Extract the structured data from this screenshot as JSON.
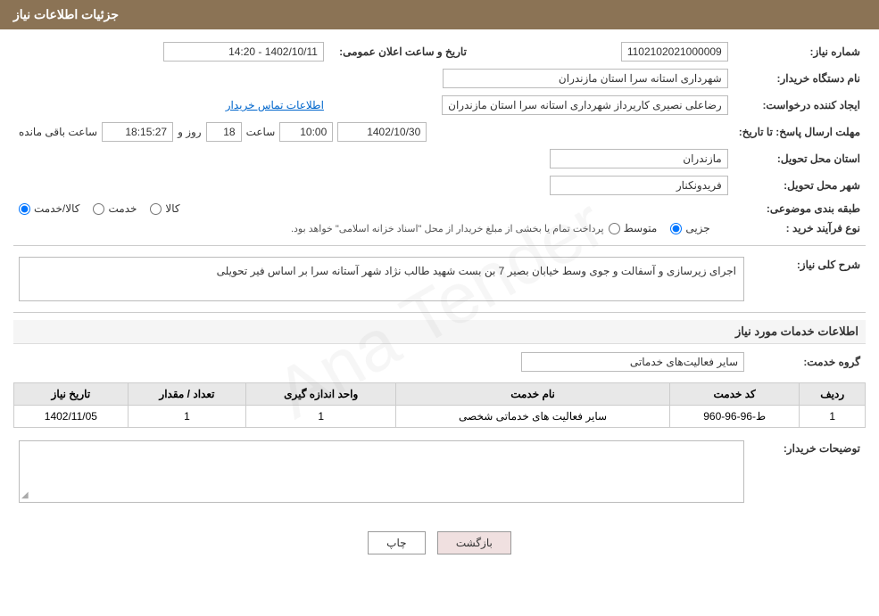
{
  "header": {
    "title": "جزئیات اطلاعات نیاز"
  },
  "fields": {
    "need_number_label": "شماره نیاز:",
    "need_number_value": "1102102021000009",
    "buyer_org_label": "نام دستگاه خریدار:",
    "buyer_org_value": "شهرداری استانه سرا استان مازندران",
    "creator_label": "ایجاد کننده درخواست:",
    "creator_value": "رضاعلی نصیری کاریرداز شهرداری استانه سرا استان مازندران",
    "creator_link": "اطلاعات تماس خریدار",
    "announce_date_label": "تاریخ و ساعت اعلان عمومی:",
    "announce_date_value": "1402/10/11 - 14:20",
    "reply_deadline_label": "مهلت ارسال پاسخ: تا تاریخ:",
    "reply_date": "1402/10/30",
    "reply_time_label": "ساعت",
    "reply_time": "10:00",
    "reply_days_label": "روز و",
    "reply_days": "18",
    "reply_remain_label": "ساعت باقی مانده",
    "reply_remain": "18:15:27",
    "province_label": "استان محل تحویل:",
    "province_value": "مازندران",
    "city_label": "شهر محل تحویل:",
    "city_value": "فریدونکنار",
    "category_label": "طبقه بندی موضوعی:",
    "category_options": [
      "کالا",
      "خدمت",
      "کالا/خدمت"
    ],
    "category_selected": "کالا/خدمت",
    "purchase_type_label": "نوع فرآیند خرید :",
    "purchase_type_options": [
      "جزیی",
      "متوسط"
    ],
    "purchase_note": "پرداخت تمام یا بخشی از مبلغ خریدار از محل \"اسناد خزانه اسلامی\" خواهد بود.",
    "description_label": "شرح کلی نیاز:",
    "description_text": "اجرای زیرسازی و آسفالت و جوی وسط خیابان بصیر 7 بن بست شهید طالب نژاد شهر آستانه سرا بر اساس فیر تحویلی",
    "services_section": "اطلاعات خدمات مورد نیاز",
    "service_group_label": "گروه خدمت:",
    "service_group_value": "سایر فعالیت‌های خدماتی",
    "table_headers": [
      "ردیف",
      "کد خدمت",
      "نام خدمت",
      "واحد اندازه گیری",
      "تعداد / مقدار",
      "تاریخ نیاز"
    ],
    "table_rows": [
      {
        "row": "1",
        "code": "ط-96-96-960",
        "name": "سایر فعالیت های خدماتی شخصی",
        "unit": "1",
        "count": "1",
        "date": "1402/11/05"
      }
    ],
    "buyer_comments_label": "توضیحات خریدار:"
  },
  "buttons": {
    "print": "چاپ",
    "back": "بازگشت"
  }
}
